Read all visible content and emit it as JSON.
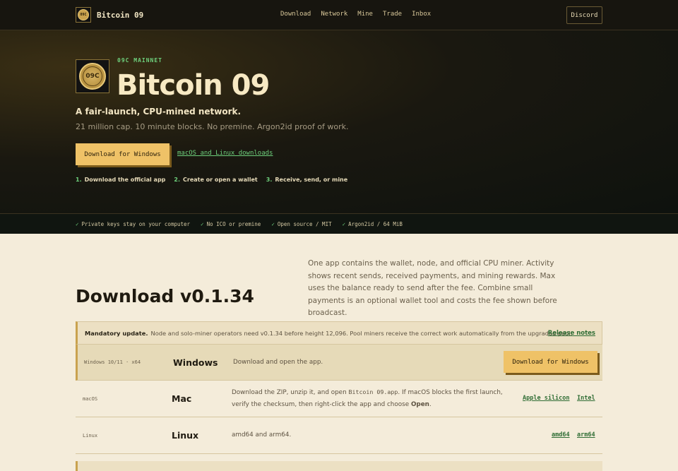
{
  "nav": {
    "brand_logo_text": "09C",
    "brand_name": "Bitcoin 09",
    "links": [
      "Download",
      "Network",
      "Mine",
      "Trade",
      "Inbox"
    ],
    "discord": "Discord"
  },
  "hero": {
    "logo_text": "09C",
    "eyebrow": "09C MAINNET",
    "title": "Bitcoin 09",
    "tagline": "A fair-launch, CPU-mined network.",
    "subline": "21 million cap. 10 minute blocks. No premine. Argon2id proof of work.",
    "cta": "Download for Windows",
    "alt_link": "macOS and Linux downloads",
    "steps": [
      {
        "n": "1.",
        "label": "Download the official app"
      },
      {
        "n": "2.",
        "label": "Create or open a wallet"
      },
      {
        "n": "3.",
        "label": "Receive, send, or mine"
      }
    ]
  },
  "features": [
    "Private keys stay on your computer",
    "No ICO or premine",
    "Open source / MIT",
    "Argon2id / 64 MiB"
  ],
  "download": {
    "blurb": "One app contains the wallet, node, and official CPU miner. Activity shows recent sends, received payments, and mining rewards. Max uses the balance ready to send after the fee. Combine small payments is an optional wallet tool and costs the fee shown before broadcast.",
    "title": "Download v0.1.34",
    "notice_bold": "Mandatory update.",
    "notice_text": "Node and solo-miner operators need v0.1.34 before height 12,096. Pool miners receive the correct work automatically from the upgraded pool.",
    "release_notes": "Release notes",
    "windows": {
      "platform": "Windows 10/11 · x64",
      "name": "Windows",
      "desc": "Download and open the app.",
      "button": "Download for Windows"
    },
    "mac": {
      "platform": "macOS",
      "name": "Mac",
      "desc_a": "Download the ZIP, unzip it, and open ",
      "desc_code": "Bitcoin 09.app",
      "desc_b": ". If macOS blocks the first launch, verify the checksum, then right-click the app and choose ",
      "desc_bold": "Open",
      "desc_end": ".",
      "link1": "Apple silicon",
      "link2": "Intel"
    },
    "linux": {
      "platform": "Linux",
      "name": "Linux",
      "desc": "amd64 and arm64.",
      "link1": "amd64",
      "link2": "arm64"
    }
  }
}
